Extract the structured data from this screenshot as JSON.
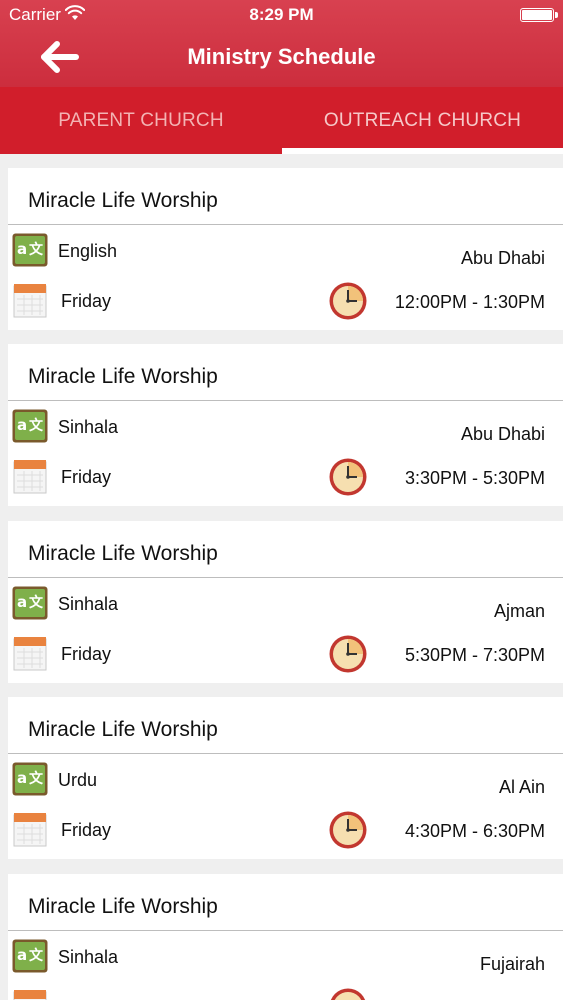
{
  "status_bar": {
    "carrier": "Carrier",
    "time": "8:29 PM",
    "icons": [
      "wifi-icon",
      "battery-icon"
    ]
  },
  "nav": {
    "title": "Ministry Schedule",
    "back_icon": "back-arrow-icon"
  },
  "tabs": [
    {
      "label": "PARENT CHURCH",
      "selected": false
    },
    {
      "label": "OUTREACH CHURCH",
      "selected": true
    }
  ],
  "colors": {
    "header": "#d33544",
    "tab_bar": "#d11e2b",
    "tab_inactive_text": "#f3b3b3",
    "background": "#efefef"
  },
  "schedule": [
    {
      "title": "Miracle Life Worship",
      "language": "English",
      "location": "Abu Dhabi",
      "day": "Friday",
      "time": "12:00PM - 1:30PM"
    },
    {
      "title": "Miracle Life Worship",
      "language": "Sinhala",
      "location": "Abu Dhabi",
      "day": "Friday",
      "time": "3:30PM - 5:30PM"
    },
    {
      "title": "Miracle Life Worship",
      "language": "Sinhala",
      "location": "Ajman",
      "day": "Friday",
      "time": "5:30PM - 7:30PM"
    },
    {
      "title": "Miracle Life Worship",
      "language": "Urdu",
      "location": "Al Ain",
      "day": "Friday",
      "time": "4:30PM - 6:30PM"
    },
    {
      "title": "Miracle Life Worship",
      "language": "Sinhala",
      "location": "Fujairah",
      "day": "",
      "time": ""
    }
  ]
}
